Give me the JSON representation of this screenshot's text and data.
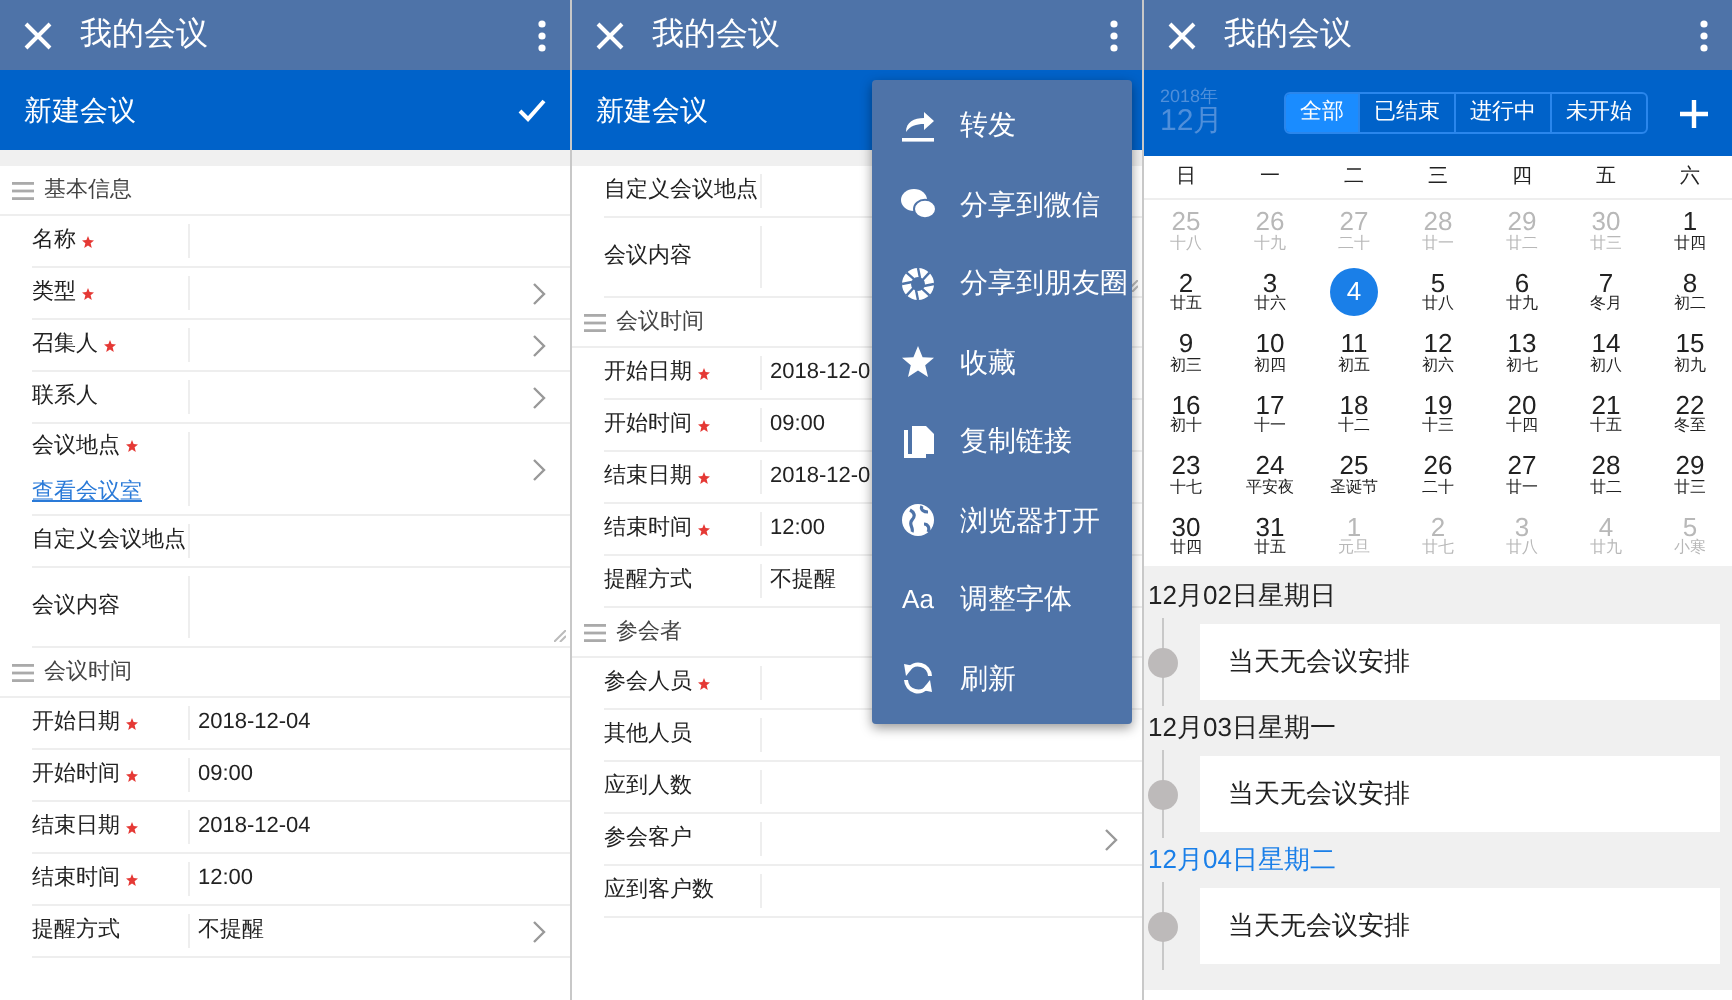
{
  "screens": [
    {
      "kind": "form",
      "title": "我的会议",
      "action_bar": {
        "title": "新建会议",
        "check": true
      },
      "sections": [
        {
          "title": "基本信息",
          "fields": [
            {
              "label": "名称",
              "required": true,
              "kind": "text"
            },
            {
              "label": "类型",
              "required": true,
              "kind": "select"
            },
            {
              "label": "召集人",
              "required": true,
              "kind": "select"
            },
            {
              "label": "联系人",
              "required": false,
              "kind": "select"
            },
            {
              "label": "会议地点",
              "required": true,
              "kind": "select",
              "link": "查看会议室"
            },
            {
              "label": "自定义会议地点",
              "required": false,
              "kind": "text"
            },
            {
              "label": "会议内容",
              "required": false,
              "kind": "textarea"
            }
          ]
        },
        {
          "title": "会议时间",
          "fields": [
            {
              "label": "开始日期",
              "required": true,
              "kind": "text",
              "value": "2018-12-04"
            },
            {
              "label": "开始时间",
              "required": true,
              "kind": "text",
              "value": "09:00"
            },
            {
              "label": "结束日期",
              "required": true,
              "kind": "text",
              "value": "2018-12-04"
            },
            {
              "label": "结束时间",
              "required": true,
              "kind": "text",
              "value": "12:00"
            },
            {
              "label": "提醒方式",
              "required": false,
              "kind": "select",
              "value": "不提醒"
            }
          ]
        }
      ]
    },
    {
      "kind": "form",
      "title": "我的会议",
      "action_bar": {
        "title": "新建会议"
      },
      "sections": [
        {
          "fields": [
            {
              "label": "自定义会议地点",
              "required": false,
              "kind": "text"
            },
            {
              "label": "会议内容",
              "required": false,
              "kind": "textarea"
            }
          ]
        },
        {
          "title": "会议时间",
          "fields": [
            {
              "label": "开始日期",
              "required": true,
              "kind": "text",
              "value": "2018-12-0"
            },
            {
              "label": "开始时间",
              "required": true,
              "kind": "text",
              "value": "09:00"
            },
            {
              "label": "结束日期",
              "required": true,
              "kind": "text",
              "value": "2018-12-0"
            },
            {
              "label": "结束时间",
              "required": true,
              "kind": "text",
              "value": "12:00"
            },
            {
              "label": "提醒方式",
              "required": false,
              "kind": "text",
              "value": "不提醒"
            }
          ]
        },
        {
          "title": "参会者",
          "fields": [
            {
              "label": "参会人员",
              "required": true,
              "kind": "select"
            },
            {
              "label": "其他人员",
              "required": false,
              "kind": "text"
            },
            {
              "label": "应到人数",
              "required": false,
              "kind": "text"
            },
            {
              "label": "参会客户",
              "required": false,
              "kind": "select"
            },
            {
              "label": "应到客户数",
              "required": false,
              "kind": "text"
            }
          ]
        }
      ],
      "menu": [
        {
          "label": "转发"
        },
        {
          "label": "分享到微信"
        },
        {
          "label": "分享到朋友圈"
        },
        {
          "label": "收藏"
        },
        {
          "label": "复制链接"
        },
        {
          "label": "浏览器打开"
        },
        {
          "label": "调整字体",
          "glyph": "Aa"
        },
        {
          "label": "刷新"
        }
      ]
    },
    {
      "kind": "calendar",
      "title": "我的会议",
      "year": "2018年",
      "month": "12月",
      "filters": [
        {
          "label": "全部",
          "selected": true
        },
        {
          "label": "已结束",
          "selected": false
        },
        {
          "label": "进行中",
          "selected": false
        },
        {
          "label": "未开始",
          "selected": false
        }
      ],
      "weekdays": [
        "日",
        "一",
        "二",
        "三",
        "四",
        "五",
        "六"
      ],
      "weeks": [
        [
          {
            "day": "25",
            "lunar": "十八",
            "other_month": true,
            "selected": false
          },
          {
            "day": "26",
            "lunar": "十九",
            "other_month": true,
            "selected": false
          },
          {
            "day": "27",
            "lunar": "二十",
            "other_month": true,
            "selected": false
          },
          {
            "day": "28",
            "lunar": "廿一",
            "other_month": true,
            "selected": false
          },
          {
            "day": "29",
            "lunar": "廿二",
            "other_month": true,
            "selected": false
          },
          {
            "day": "30",
            "lunar": "廿三",
            "other_month": true,
            "selected": false
          },
          {
            "day": "1",
            "lunar": "廿四",
            "other_month": false,
            "selected": false
          }
        ],
        [
          {
            "day": "2",
            "lunar": "廿五",
            "other_month": false,
            "selected": false
          },
          {
            "day": "3",
            "lunar": "廿六",
            "other_month": false,
            "selected": false
          },
          {
            "day": "4",
            "other_month": false,
            "selected": true
          },
          {
            "day": "5",
            "lunar": "廿八",
            "other_month": false,
            "selected": false
          },
          {
            "day": "6",
            "lunar": "廿九",
            "other_month": false,
            "selected": false
          },
          {
            "day": "7",
            "lunar": "冬月",
            "other_month": false,
            "selected": false
          },
          {
            "day": "8",
            "lunar": "初二",
            "other_month": false,
            "selected": false
          }
        ],
        [
          {
            "day": "9",
            "lunar": "初三",
            "other_month": false,
            "selected": false
          },
          {
            "day": "10",
            "lunar": "初四",
            "other_month": false,
            "selected": false
          },
          {
            "day": "11",
            "lunar": "初五",
            "other_month": false,
            "selected": false
          },
          {
            "day": "12",
            "lunar": "初六",
            "other_month": false,
            "selected": false
          },
          {
            "day": "13",
            "lunar": "初七",
            "other_month": false,
            "selected": false
          },
          {
            "day": "14",
            "lunar": "初八",
            "other_month": false,
            "selected": false
          },
          {
            "day": "15",
            "lunar": "初九",
            "other_month": false,
            "selected": false
          }
        ],
        [
          {
            "day": "16",
            "lunar": "初十",
            "other_month": false,
            "selected": false
          },
          {
            "day": "17",
            "lunar": "十一",
            "other_month": false,
            "selected": false
          },
          {
            "day": "18",
            "lunar": "十二",
            "other_month": false,
            "selected": false
          },
          {
            "day": "19",
            "lunar": "十三",
            "other_month": false,
            "selected": false
          },
          {
            "day": "20",
            "lunar": "十四",
            "other_month": false,
            "selected": false
          },
          {
            "day": "21",
            "lunar": "十五",
            "other_month": false,
            "selected": false
          },
          {
            "day": "22",
            "lunar": "冬至",
            "other_month": false,
            "selected": false
          }
        ],
        [
          {
            "day": "23",
            "lunar": "十七",
            "other_month": false,
            "selected": false
          },
          {
            "day": "24",
            "lunar": "平安夜",
            "other_month": false,
            "selected": false
          },
          {
            "day": "25",
            "lunar": "圣诞节",
            "other_month": false,
            "selected": false
          },
          {
            "day": "26",
            "lunar": "二十",
            "other_month": false,
            "selected": false
          },
          {
            "day": "27",
            "lunar": "廿一",
            "other_month": false,
            "selected": false
          },
          {
            "day": "28",
            "lunar": "廿二",
            "other_month": false,
            "selected": false
          },
          {
            "day": "29",
            "lunar": "廿三",
            "other_month": false,
            "selected": false
          }
        ],
        [
          {
            "day": "30",
            "lunar": "廿四",
            "other_month": false,
            "selected": false
          },
          {
            "day": "31",
            "lunar": "廿五",
            "other_month": false,
            "selected": false
          },
          {
            "day": "1",
            "lunar": "元旦",
            "other_month": true,
            "selected": false
          },
          {
            "day": "2",
            "lunar": "廿七",
            "other_month": true,
            "selected": false
          },
          {
            "day": "3",
            "lunar": "廿八",
            "other_month": true,
            "selected": false
          },
          {
            "day": "4",
            "lunar": "廿九",
            "other_month": true,
            "selected": false
          },
          {
            "day": "5",
            "lunar": "小寒",
            "other_month": true,
            "selected": false
          }
        ]
      ],
      "agenda": [
        {
          "date": "12月02日星期日",
          "current": false,
          "entries": [
            "当天无会议安排"
          ]
        },
        {
          "date": "12月03日星期一",
          "current": false,
          "entries": [
            "当天无会议安排"
          ]
        },
        {
          "date": "12月04日星期二",
          "current": true,
          "entries": [
            "当天无会议安排"
          ]
        }
      ]
    }
  ]
}
